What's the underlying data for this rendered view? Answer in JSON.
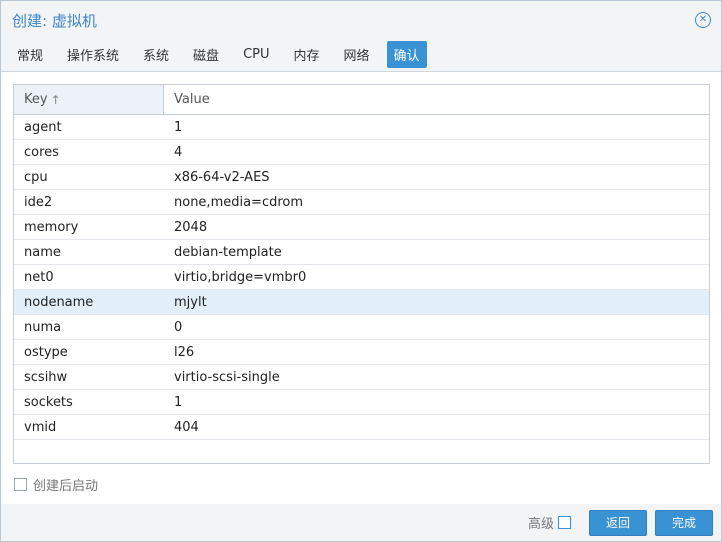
{
  "window": {
    "title": "创建: 虚拟机",
    "close_icon": "close-icon"
  },
  "tabs": [
    {
      "label": "常规",
      "active": false
    },
    {
      "label": "操作系统",
      "active": false
    },
    {
      "label": "系统",
      "active": false
    },
    {
      "label": "磁盘",
      "active": false
    },
    {
      "label": "CPU",
      "active": false
    },
    {
      "label": "内存",
      "active": false
    },
    {
      "label": "网络",
      "active": false
    },
    {
      "label": "确认",
      "active": true
    }
  ],
  "grid": {
    "columns": [
      "Key",
      "Value"
    ],
    "sort_icon": "↑",
    "rows": [
      {
        "key": "agent",
        "value": "1"
      },
      {
        "key": "cores",
        "value": "4"
      },
      {
        "key": "cpu",
        "value": "x86-64-v2-AES"
      },
      {
        "key": "ide2",
        "value": "none,media=cdrom"
      },
      {
        "key": "memory",
        "value": "2048"
      },
      {
        "key": "name",
        "value": "debian-template"
      },
      {
        "key": "net0",
        "value": "virtio,bridge=vmbr0"
      },
      {
        "key": "nodename",
        "value": "mjylt",
        "selected": true
      },
      {
        "key": "numa",
        "value": "0"
      },
      {
        "key": "ostype",
        "value": "l26"
      },
      {
        "key": "scsihw",
        "value": "virtio-scsi-single"
      },
      {
        "key": "sockets",
        "value": "1"
      },
      {
        "key": "vmid",
        "value": "404"
      }
    ]
  },
  "start_after_create": {
    "label": "创建后启动",
    "checked": false
  },
  "footer": {
    "advanced_label": "高级",
    "back_label": "返回",
    "finish_label": "完成"
  },
  "colors": {
    "accent": "#3892d3",
    "title": "#3d86c6",
    "selected_row": "#e2eef8"
  }
}
